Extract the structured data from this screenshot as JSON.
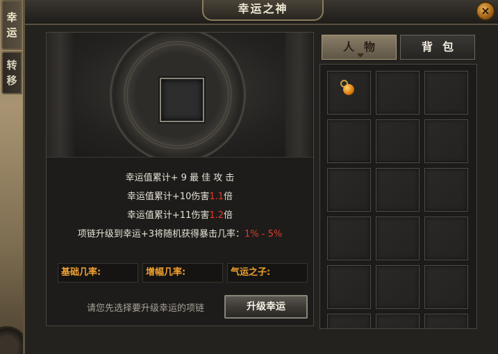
{
  "window": {
    "title": "幸运之神",
    "close_label": "×"
  },
  "side_tabs": [
    {
      "chars": [
        "幸",
        "运"
      ],
      "active": true
    },
    {
      "chars": [
        "转",
        "移"
      ],
      "active": false
    }
  ],
  "info_lines": {
    "line1": "幸运值累计+ 9 最 佳 攻 击",
    "line2_prefix": "幸运值累计+10伤害",
    "line2_value": "1.1",
    "line2_suffix": "倍",
    "line3_prefix": "幸运值累计+11伤害",
    "line3_value": "1.2",
    "line3_suffix": "倍",
    "line4_prefix": "项链升级到幸运+3将随机获得暴击几率：",
    "line4_value": "1% - 5%"
  },
  "stats": {
    "base_rate_label": "基础几率:",
    "boost_rate_label": "增幅几率:",
    "luck_son_label": "气运之子:"
  },
  "hint": "请您先选择要升级幸运的项链",
  "upgrade_button": "升级幸运",
  "tabs": {
    "character": "人物",
    "backpack": "背包"
  },
  "inventory": {
    "rows": 6,
    "cols": 3,
    "items": [
      {
        "slot": 0,
        "icon": "amulet-icon"
      }
    ]
  },
  "colors": {
    "highlight_red": "#e23a2a",
    "stat_orange": "#f0a030"
  }
}
